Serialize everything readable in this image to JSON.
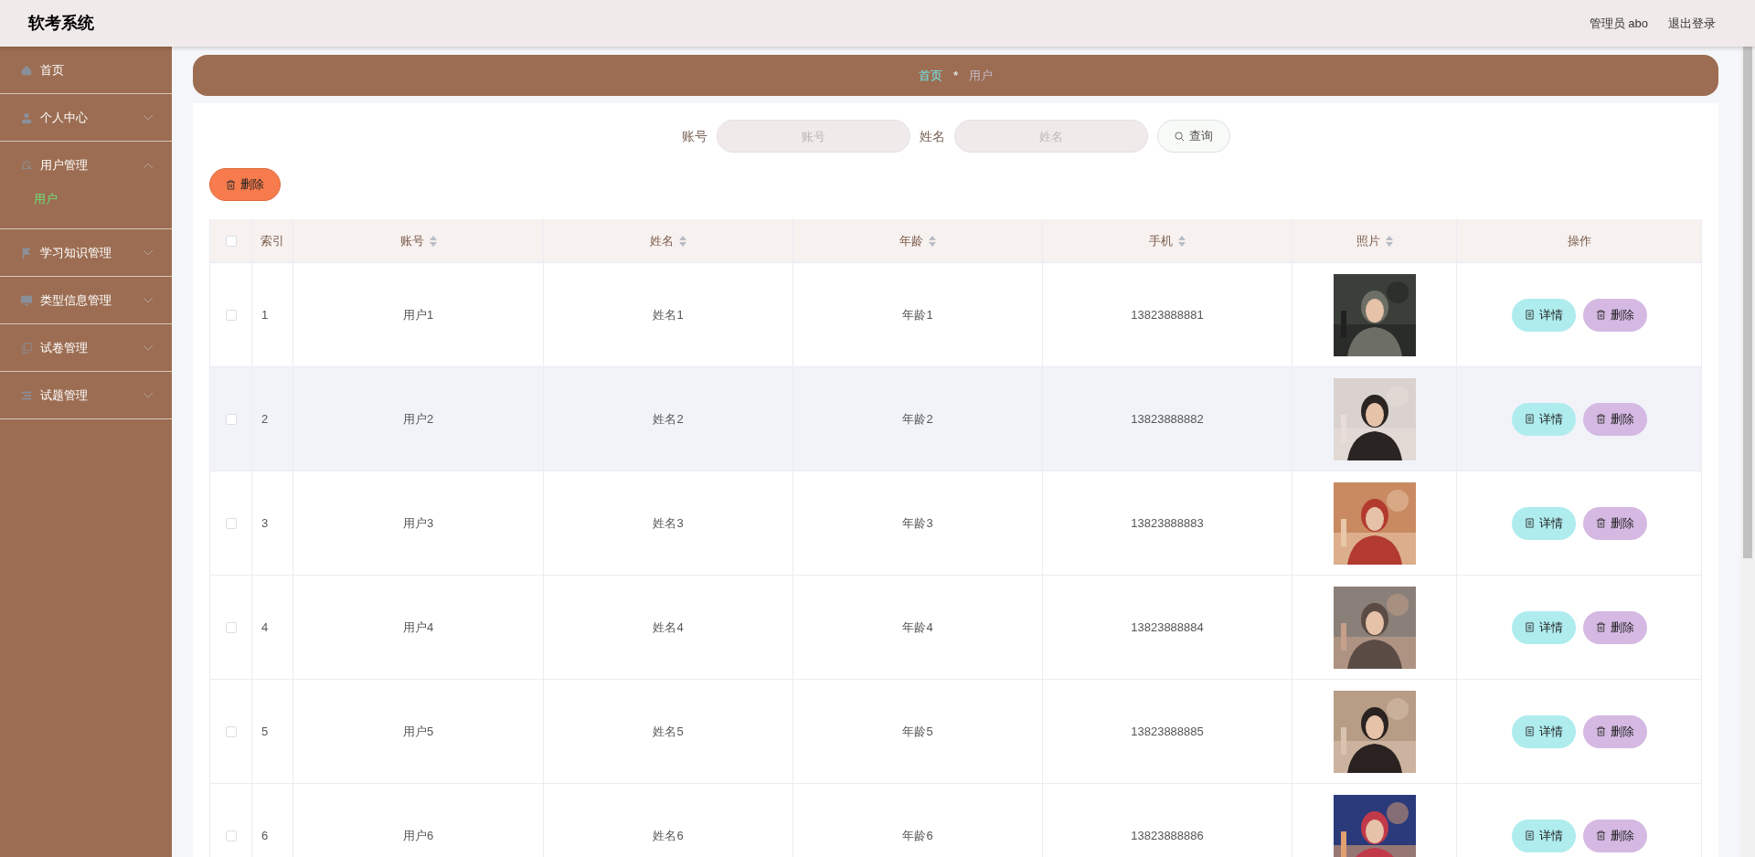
{
  "header": {
    "title": "软考系统",
    "user": "管理员 abo",
    "logout": "退出登录"
  },
  "sidebar": {
    "items": [
      {
        "label": "首页"
      },
      {
        "label": "个人中心",
        "expanded": false
      },
      {
        "label": "用户管理",
        "expanded": true,
        "children": [
          {
            "label": "用户",
            "selected": true
          }
        ]
      },
      {
        "label": "学习知识管理",
        "expanded": false
      },
      {
        "label": "类型信息管理",
        "expanded": false
      },
      {
        "label": "试卷管理",
        "expanded": false
      },
      {
        "label": "试题管理",
        "expanded": false
      }
    ]
  },
  "breadcrumb": [
    {
      "label": "首页",
      "selected": false
    },
    {
      "label": "用户",
      "selected": true
    }
  ],
  "breadcrumb_separator": "*",
  "search": {
    "fields": [
      {
        "label": "账号",
        "placeholder": "账号"
      },
      {
        "label": "姓名",
        "placeholder": "姓名"
      }
    ],
    "button": "查询"
  },
  "bulk_delete": "删除",
  "table": {
    "select_all_checked": false,
    "columns": [
      {
        "label": "索引",
        "sortable": false
      },
      {
        "label": "账号",
        "sortable": true
      },
      {
        "label": "姓名",
        "sortable": true
      },
      {
        "label": "年龄",
        "sortable": true
      },
      {
        "label": "手机",
        "sortable": true
      },
      {
        "label": "照片",
        "sortable": true
      },
      {
        "label": "操作",
        "sortable": false
      }
    ],
    "rows": [
      {
        "index": "1",
        "account": "用户1",
        "name": "姓名1",
        "age": "年龄1",
        "phone": "13823888881",
        "detail": "详情",
        "delete": "删除",
        "checked": false,
        "hovered": false
      },
      {
        "index": "2",
        "account": "用户2",
        "name": "姓名2",
        "age": "年龄2",
        "phone": "13823888882",
        "detail": "详情",
        "delete": "删除",
        "checked": false,
        "hovered": true
      },
      {
        "index": "3",
        "account": "用户3",
        "name": "姓名3",
        "age": "年龄3",
        "phone": "13823888883",
        "detail": "详情",
        "delete": "删除",
        "checked": false,
        "hovered": false
      },
      {
        "index": "4",
        "account": "用户4",
        "name": "姓名4",
        "age": "年龄4",
        "phone": "13823888884",
        "detail": "详情",
        "delete": "删除",
        "checked": false,
        "hovered": false
      },
      {
        "index": "5",
        "account": "用户5",
        "name": "姓名5",
        "age": "年龄5",
        "phone": "13823888885",
        "detail": "详情",
        "delete": "删除",
        "checked": false,
        "hovered": false
      },
      {
        "index": "6",
        "account": "用户6",
        "name": "姓名6",
        "age": "年龄6",
        "phone": "13823888886",
        "detail": "详情",
        "delete": "删除",
        "checked": false,
        "hovered": false
      }
    ]
  }
}
